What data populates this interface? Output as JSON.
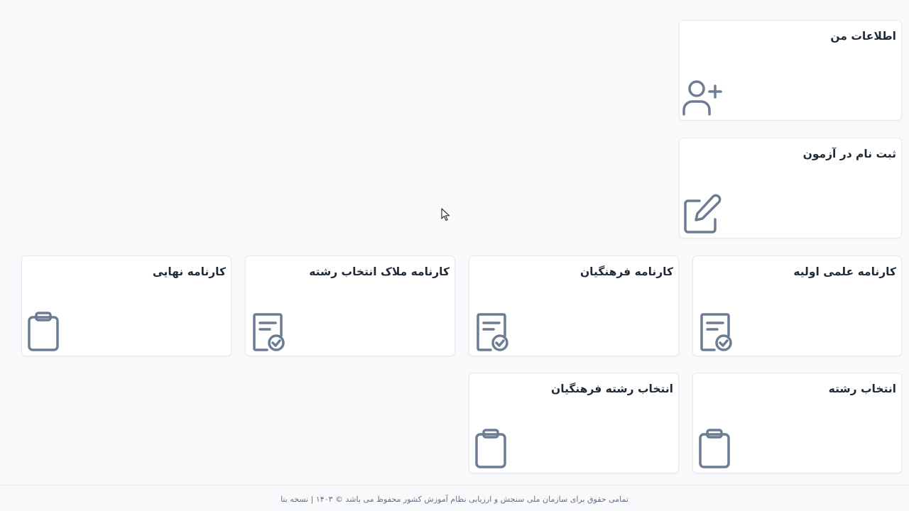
{
  "cards": {
    "my_info": {
      "title": "اطلاعات من",
      "icon": "user-plus-icon"
    },
    "exam_registration": {
      "title": "ثبت نام در آزمون",
      "icon": "edit-icon"
    },
    "initial_scientific_report": {
      "title": "کارنامه علمی اولیه",
      "icon": "document-check-icon"
    },
    "farhangian_report": {
      "title": "کارنامه فرهنگیان",
      "icon": "document-check-icon"
    },
    "major_selection_criteria_report": {
      "title": "کارنامه ملاک انتخاب رشته",
      "icon": "document-check-icon"
    },
    "final_report": {
      "title": "کارنامه نهایی",
      "icon": "clipboard-icon"
    },
    "major_selection": {
      "title": "انتخاب رشته",
      "icon": "clipboard-icon"
    },
    "farhangian_major_selection": {
      "title": "انتخاب رشته فرهنگیان",
      "icon": "clipboard-icon"
    }
  },
  "footer": {
    "text": "تمامی حقوق برای سازمان ملی سنجش و ارزیابی نظام آموزش کشور محفوظ می باشد © ۱۴۰۳ | نسخه بتا"
  },
  "colors": {
    "icon": "#6b7c93",
    "card_border": "#e6e9ee",
    "background": "#f8f9fb"
  }
}
